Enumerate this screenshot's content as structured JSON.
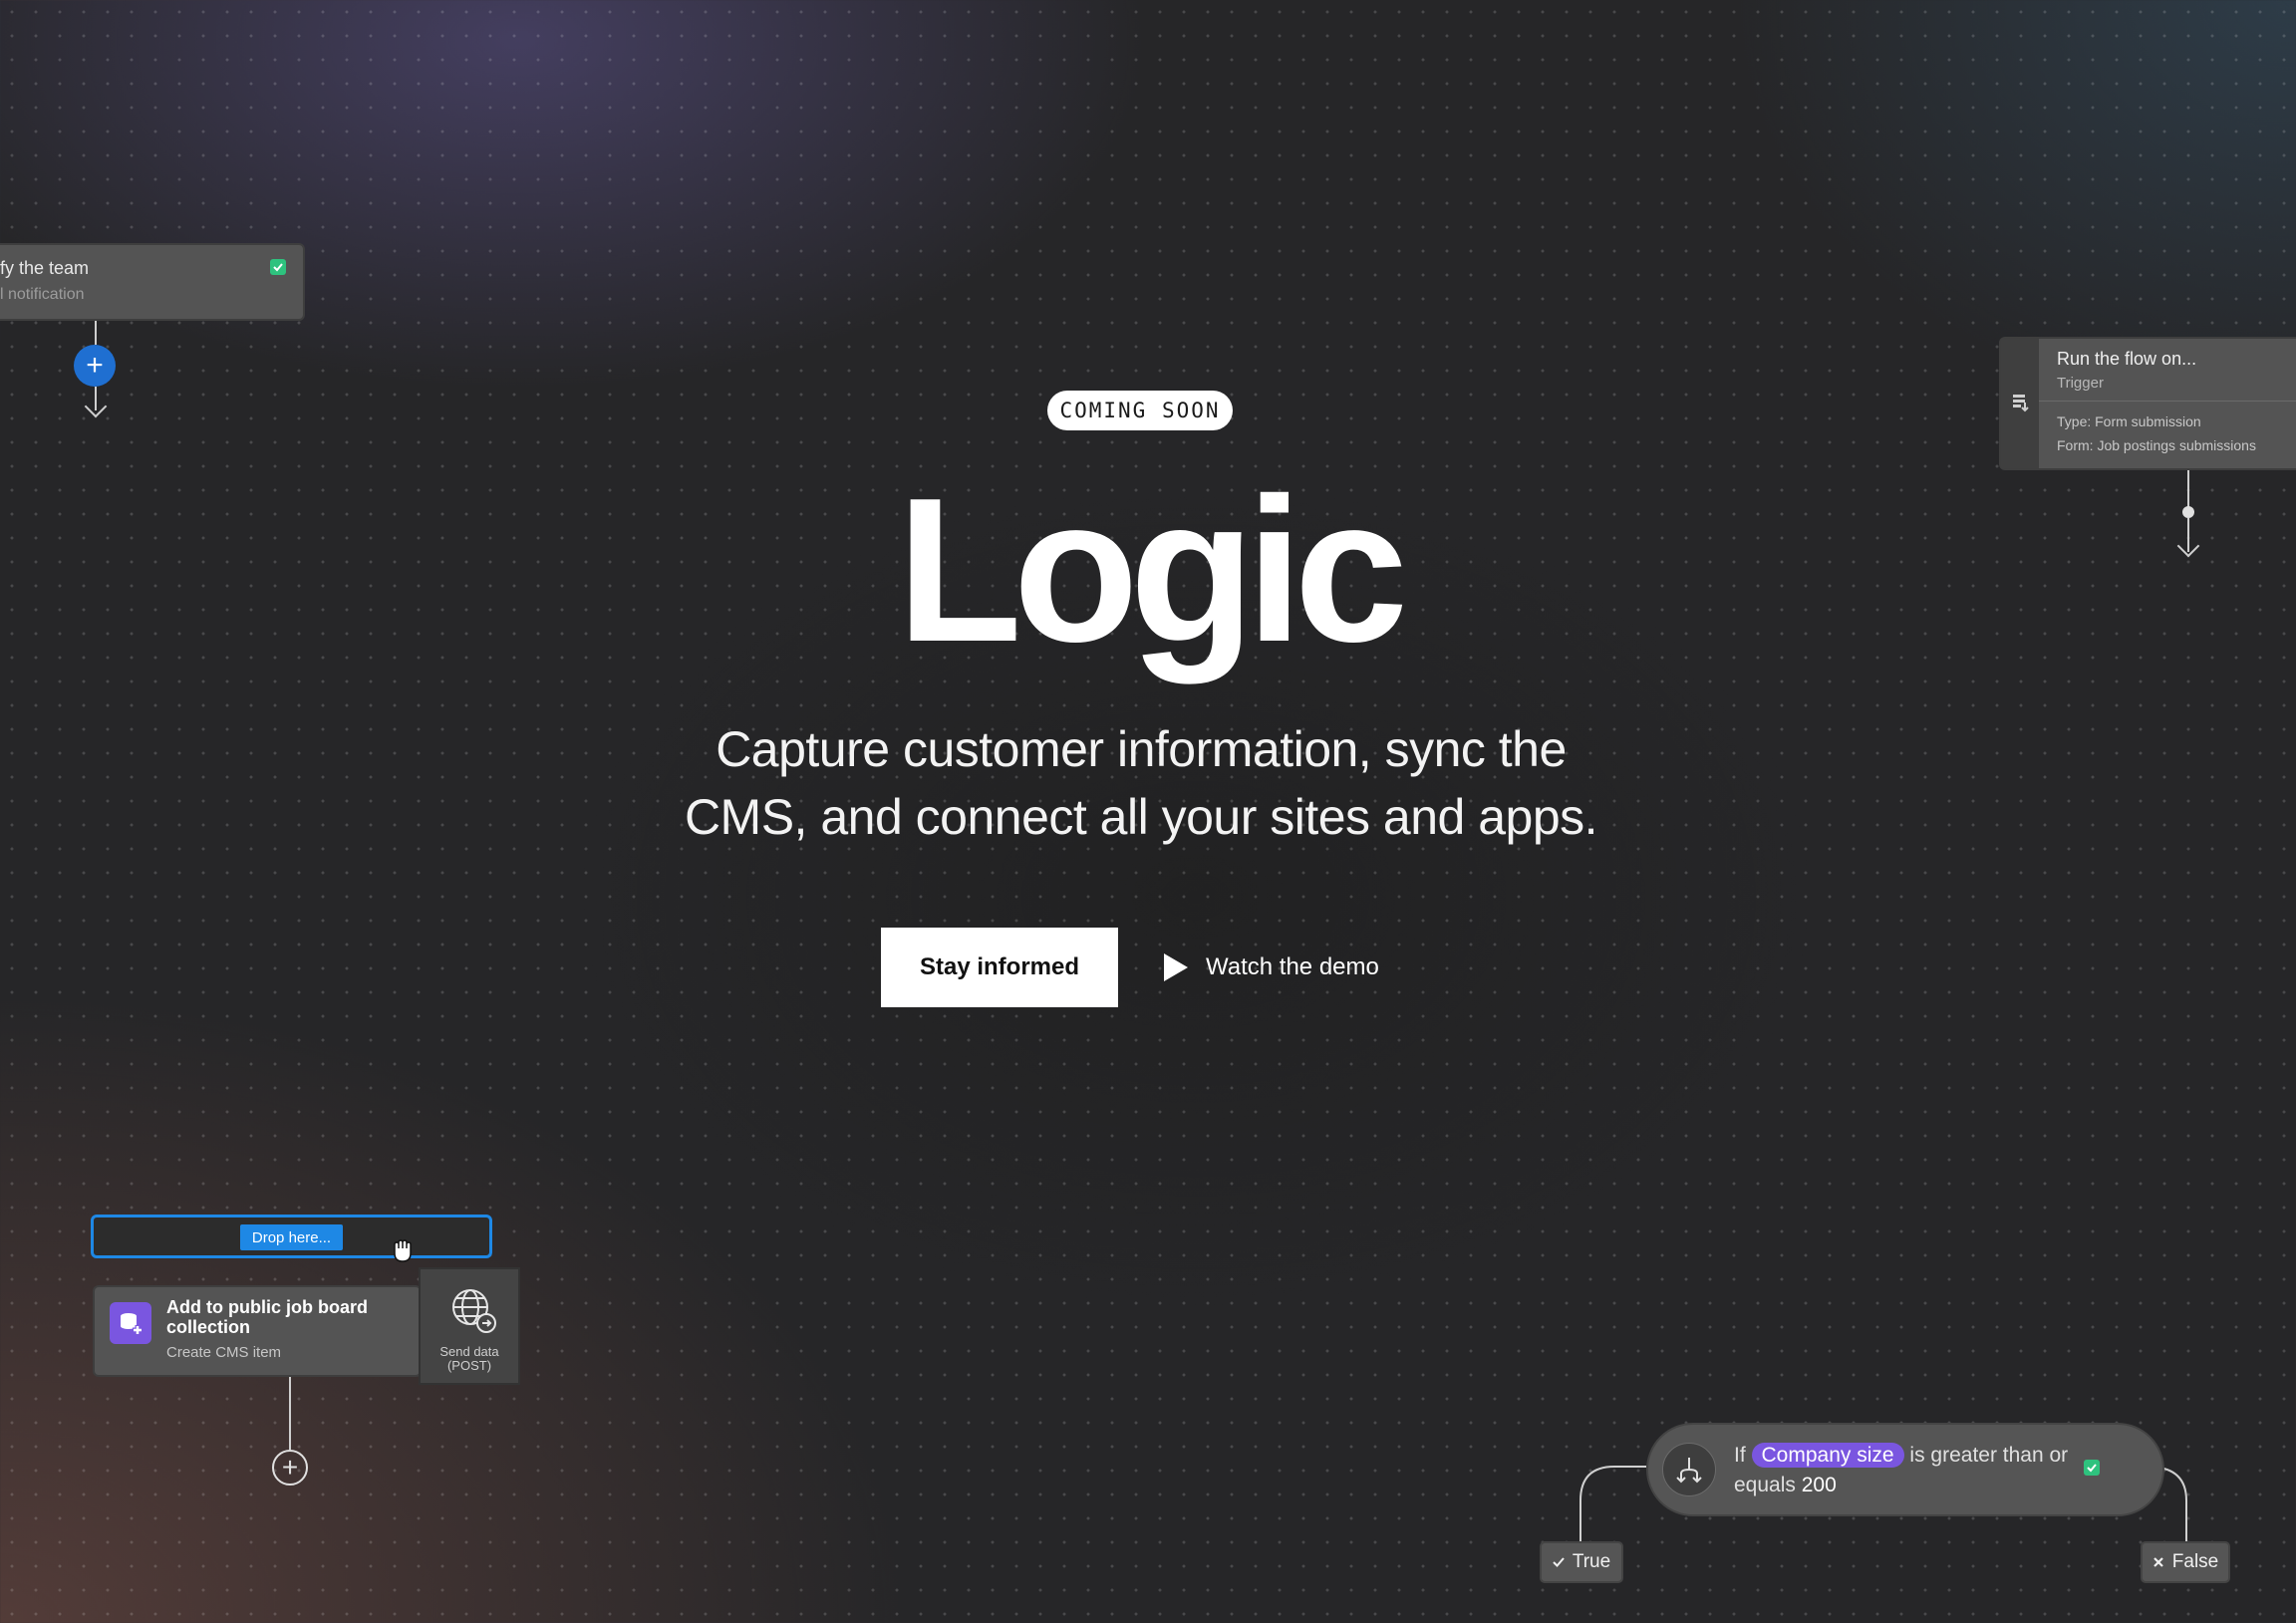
{
  "hero": {
    "badge": "COMING SOON",
    "title": "Logic",
    "subtitle_line1": "Capture customer information, sync the",
    "subtitle_line2": "CMS, and connect all your sites and apps.",
    "primary_button": "Stay informed",
    "demo_button": "Watch the demo"
  },
  "nodes": {
    "notify": {
      "title": "fy the team",
      "subtitle": "l notification"
    },
    "trigger": {
      "title": "Run the flow on...",
      "subtitle": "Trigger",
      "type_line": "Type: Form submission",
      "form_line": "Form: Job postings submissions"
    },
    "drop_zone": {
      "label": "Drop here..."
    },
    "job": {
      "title": "Add to public job board collection",
      "subtitle": "Create CMS item"
    },
    "send": {
      "label": "Send data (POST)"
    },
    "condition": {
      "prefix": "If",
      "field": "Company size",
      "operator": "is greater than or equals",
      "value": "200"
    },
    "true_label": "True",
    "false_label": "False"
  },
  "colors": {
    "accent_blue": "#1e88e5",
    "check_green": "#2ec27e",
    "chip_purple": "#7a56e0"
  }
}
